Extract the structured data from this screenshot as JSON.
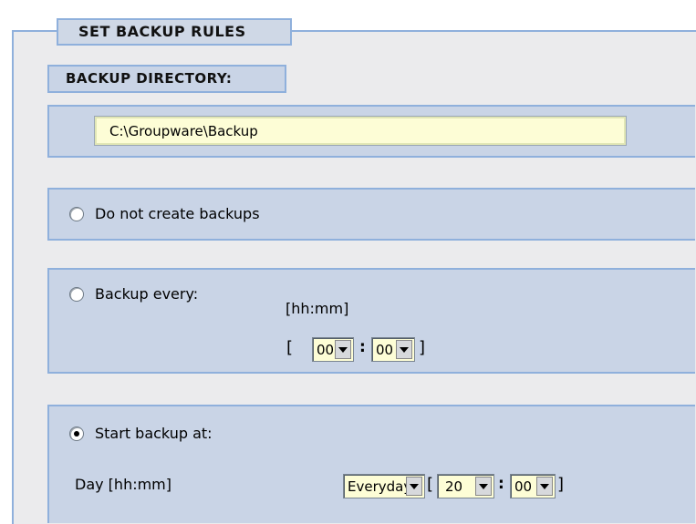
{
  "legend": "SET BACKUP RULES",
  "backup_directory": {
    "label": "BACKUP DIRECTORY:",
    "value": "C:\\Groupware\\Backup"
  },
  "options": {
    "no_backup": {
      "label": "Do not create backups",
      "checked": false
    },
    "backup_every": {
      "label": "Backup every:",
      "checked": false,
      "format_label": "[hh:mm]",
      "bracket_open": "[",
      "colon": ":",
      "bracket_close": "]",
      "hours": "00",
      "minutes": "00"
    },
    "start_backup_at": {
      "label": "Start backup at:",
      "checked": true,
      "day_label": "Day [hh:mm]",
      "day": "Everyday",
      "bracket_open": "[",
      "colon": ":",
      "bracket_close": "]",
      "hours": "20",
      "minutes": "00"
    }
  },
  "colors": {
    "panel": "#c9d4e6",
    "border": "#8fb0dc",
    "input_bg": "#fdfdd6"
  }
}
